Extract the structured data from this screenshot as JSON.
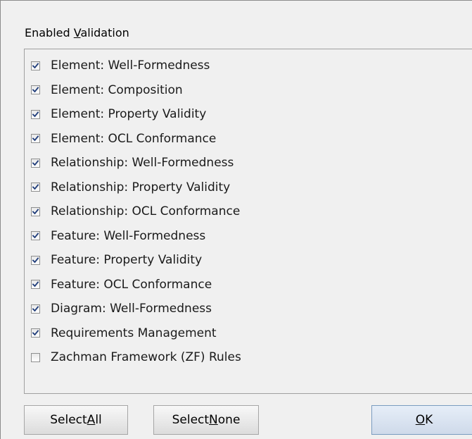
{
  "group": {
    "label_before": "Enabled ",
    "label_key": "V",
    "label_after": "alidation"
  },
  "items": [
    {
      "label": "Element: Well-Formedness",
      "checked": true
    },
    {
      "label": "Element: Composition",
      "checked": true
    },
    {
      "label": "Element: Property Validity",
      "checked": true
    },
    {
      "label": "Element: OCL Conformance",
      "checked": true
    },
    {
      "label": "Relationship: Well-Formedness",
      "checked": true
    },
    {
      "label": "Relationship: Property Validity",
      "checked": true
    },
    {
      "label": "Relationship: OCL Conformance",
      "checked": true
    },
    {
      "label": "Feature: Well-Formedness",
      "checked": true
    },
    {
      "label": "Feature: Property Validity",
      "checked": true
    },
    {
      "label": "Feature: OCL Conformance",
      "checked": true
    },
    {
      "label": "Diagram: Well-Formedness",
      "checked": true
    },
    {
      "label": "Requirements Management",
      "checked": true
    },
    {
      "label": "Zachman Framework (ZF) Rules",
      "checked": false
    }
  ],
  "buttons": {
    "select_all": {
      "before": "Select ",
      "key": "A",
      "after": "ll"
    },
    "select_none": {
      "before": "Select ",
      "key": "N",
      "after": "one"
    },
    "ok": {
      "before": "",
      "key": "O",
      "after": "K"
    }
  }
}
